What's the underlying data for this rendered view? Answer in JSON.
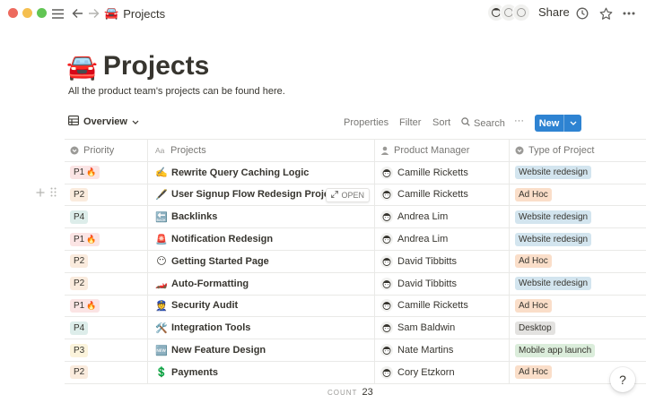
{
  "window": {
    "breadcrumb_emoji": "🚘",
    "breadcrumb_title": "Projects",
    "share_label": "Share"
  },
  "page": {
    "emoji": "🚘",
    "title": "Projects",
    "description": "All the product team's projects can be found here."
  },
  "view": {
    "name": "Overview",
    "properties": "Properties",
    "filter": "Filter",
    "sort": "Sort",
    "search": "Search",
    "more": "···",
    "new_label": "New"
  },
  "columns": {
    "priority": "Priority",
    "projects": "Projects",
    "manager": "Product Manager",
    "type": "Type of Project"
  },
  "rows": [
    {
      "priority": "P1",
      "fire": "🔥",
      "emoji": "✍️",
      "project": "Rewrite Query Caching Logic",
      "manager": "Camille Ricketts",
      "type": "Website redesign"
    },
    {
      "priority": "P2",
      "fire": "",
      "emoji": "🖋️",
      "project": "User Signup Flow Redesign Project",
      "manager": "Camille Ricketts",
      "type": "Ad Hoc"
    },
    {
      "priority": "P4",
      "fire": "",
      "emoji": "🔙",
      "project": "Backlinks",
      "manager": "Andrea Lim",
      "type": "Website redesign"
    },
    {
      "priority": "P1",
      "fire": "🔥",
      "emoji": "🚨",
      "project": "Notification Redesign",
      "manager": "Andrea Lim",
      "type": "Website redesign"
    },
    {
      "priority": "P2",
      "fire": "",
      "emoji": "😶",
      "project": "Getting Started Page",
      "manager": "David Tibbitts",
      "type": "Ad Hoc"
    },
    {
      "priority": "P2",
      "fire": "",
      "emoji": "🏎️",
      "project": "Auto-Formatting",
      "manager": "David Tibbitts",
      "type": "Website redesign"
    },
    {
      "priority": "P1",
      "fire": "🔥",
      "emoji": "👮",
      "project": "Security Audit",
      "manager": "Camille Ricketts",
      "type": "Ad Hoc"
    },
    {
      "priority": "P4",
      "fire": "",
      "emoji": "🛠️",
      "project": "Integration Tools",
      "manager": "Sam Baldwin",
      "type": "Desktop"
    },
    {
      "priority": "P3",
      "fire": "",
      "emoji": "🆕",
      "project": "New Feature Design",
      "manager": "Nate Martins",
      "type": "Mobile app launch"
    },
    {
      "priority": "P2",
      "fire": "",
      "emoji": "💲",
      "project": "Payments",
      "manager": "Cory Etzkorn",
      "type": "Ad Hoc"
    }
  ],
  "open_label": "OPEN",
  "footer": {
    "count_label": "COUNT",
    "count_value": "23"
  },
  "help_label": "?",
  "colors": {
    "accent": "#2e83d2",
    "p1": "#fbe4e4",
    "p2": "#faebdd",
    "p3": "#fbf3db",
    "p4": "#ddedea",
    "website_redesign": "#d3e5ef",
    "ad_hoc": "#fadec9",
    "desktop": "#e3e2e0",
    "mobile_app_launch": "#dbeddb"
  }
}
